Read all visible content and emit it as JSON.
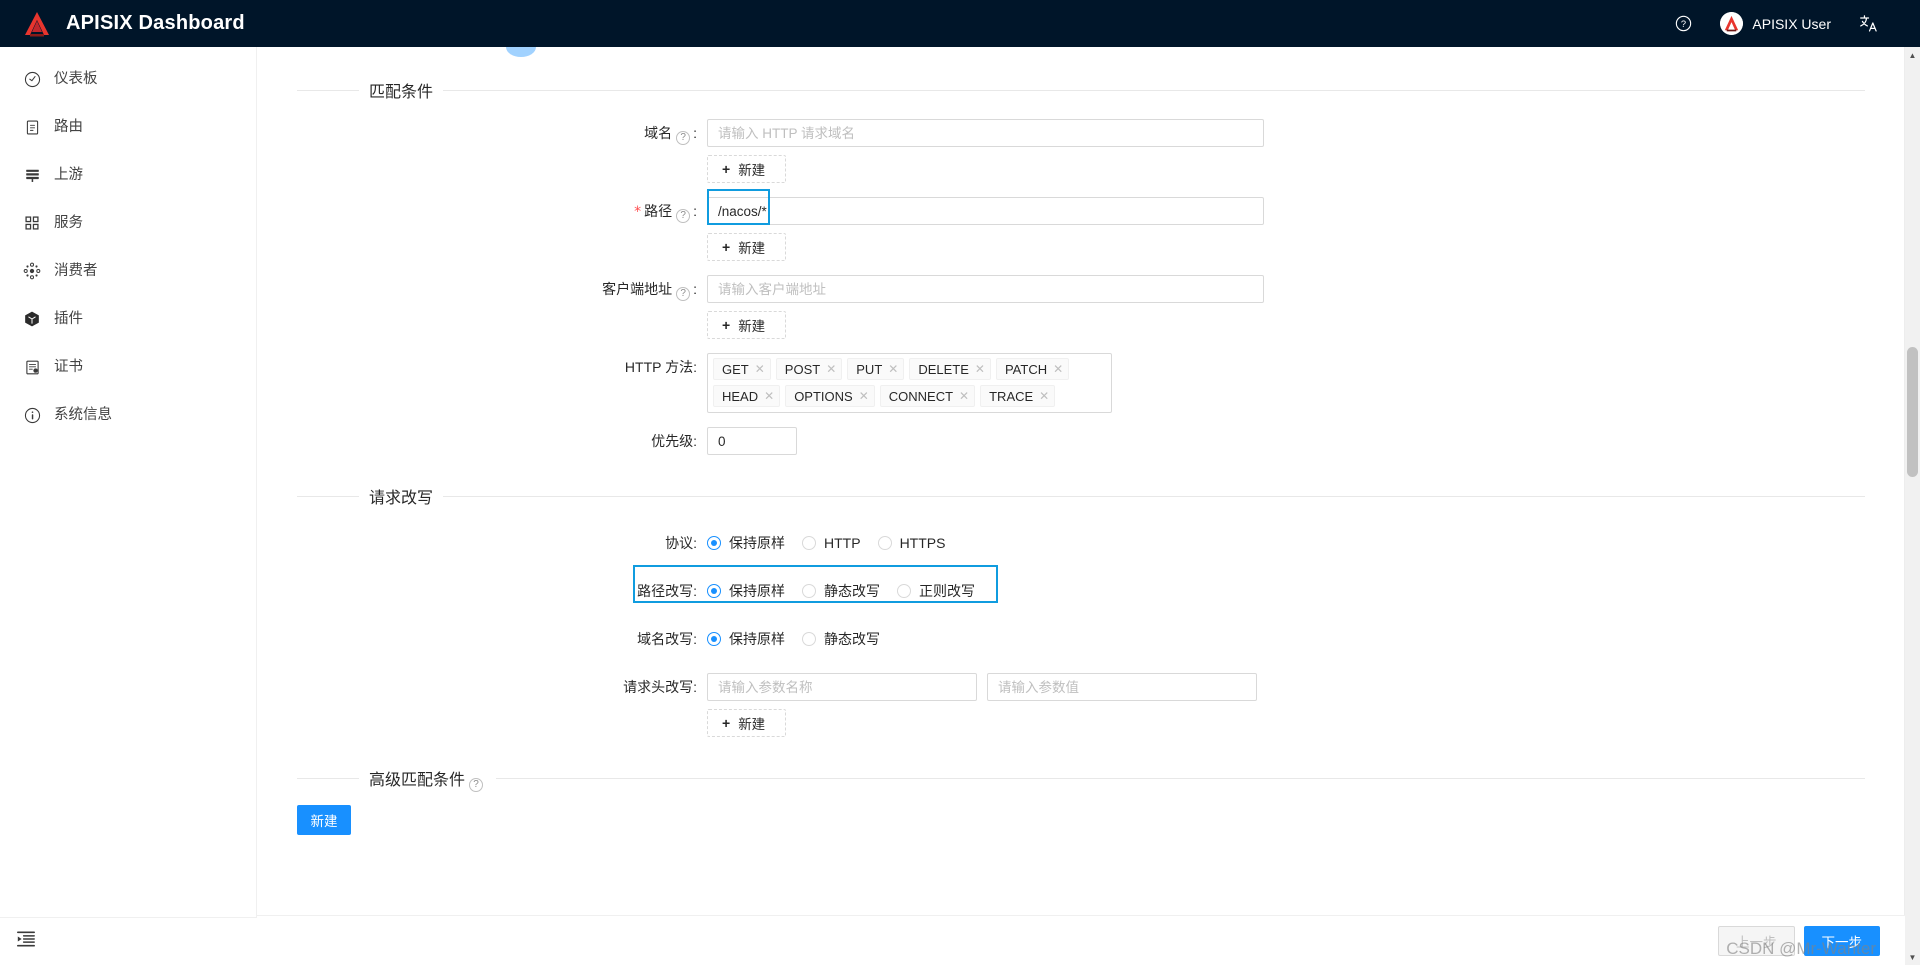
{
  "header": {
    "brand_title": "APISIX Dashboard",
    "logo_icon": "apisix-logo-icon",
    "help_icon": "question-circle-icon",
    "user_name": "APISIX User",
    "avatar_icon": "apisix-avatar-icon",
    "language_icon": "translate-icon"
  },
  "sidebar": {
    "items": [
      {
        "label": "仪表板",
        "icon": "dashboard-icon"
      },
      {
        "label": "路由",
        "icon": "route-icon"
      },
      {
        "label": "上游",
        "icon": "upstream-icon"
      },
      {
        "label": "服务",
        "icon": "service-icon"
      },
      {
        "label": "消费者",
        "icon": "consumer-icon"
      },
      {
        "label": "插件",
        "icon": "plugin-icon"
      },
      {
        "label": "证书",
        "icon": "certificate-icon"
      },
      {
        "label": "系统信息",
        "icon": "info-circle-icon"
      }
    ],
    "collapse_icon": "menu-fold-icon"
  },
  "form": {
    "match_section": {
      "title": "匹配条件",
      "host": {
        "label": "域名",
        "help_icon": "question-circle-icon",
        "value": "",
        "placeholder": "请输入 HTTP 请求域名",
        "add_label": "新建"
      },
      "path": {
        "label": "路径",
        "required": true,
        "required_mark": "*",
        "help_icon": "question-circle-icon",
        "value": "/nacos/*",
        "placeholder": "",
        "add_label": "新建",
        "highlighted": true
      },
      "remote_addr": {
        "label": "客户端地址",
        "help_icon": "question-circle-icon",
        "value": "",
        "placeholder": "请输入客户端地址",
        "add_label": "新建"
      },
      "http_methods": {
        "label": "HTTP 方法",
        "tags": [
          "GET",
          "POST",
          "PUT",
          "DELETE",
          "PATCH",
          "HEAD",
          "OPTIONS",
          "CONNECT",
          "TRACE"
        ],
        "remove_icon": "close-icon"
      },
      "priority": {
        "label": "优先级",
        "value": "0"
      }
    },
    "rewrite_section": {
      "title": "请求改写",
      "scheme": {
        "label": "协议",
        "options": [
          "保持原样",
          "HTTP",
          "HTTPS"
        ],
        "selected": "保持原样"
      },
      "path_rewrite": {
        "label": "路径改写",
        "options": [
          "保持原样",
          "静态改写",
          "正则改写"
        ],
        "selected": "保持原样",
        "highlighted": true
      },
      "host_rewrite": {
        "label": "域名改写",
        "options": [
          "保持原样",
          "静态改写"
        ],
        "selected": "保持原样"
      },
      "header_rewrite": {
        "label": "请求头改写",
        "name_value": "",
        "name_placeholder": "请输入参数名称",
        "val_value": "",
        "val_placeholder": "请输入参数值",
        "add_label": "新建"
      }
    },
    "advanced_section": {
      "title": "高级匹配条件",
      "help_icon": "question-circle-icon",
      "add_label": "新建"
    }
  },
  "footer": {
    "prev_label": "上一步",
    "next_label": "下一步"
  },
  "watermark": "CSDN @Mr-Wanter",
  "colors": {
    "brand_dark": "#001529",
    "primary": "#1890ff",
    "highlight_outline": "#109cdf",
    "required_red": "#ff4d4f"
  }
}
